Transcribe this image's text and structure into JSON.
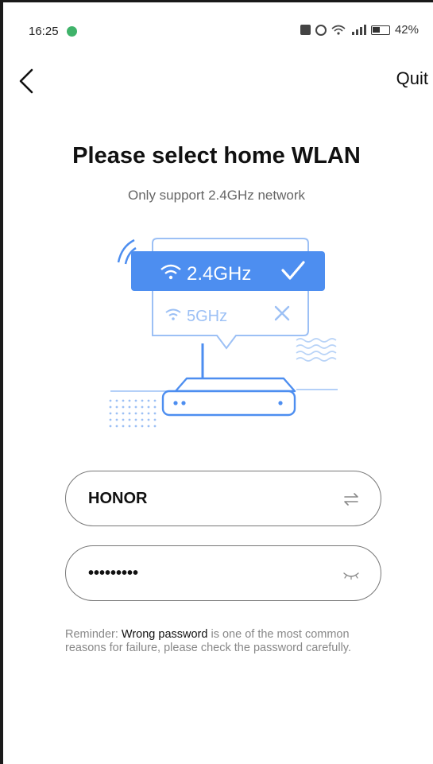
{
  "status_bar": {
    "time": "16:25",
    "battery": "42%",
    "icons": [
      "notification-icon",
      "nfc-icon",
      "wifi-icon",
      "signal-icon",
      "battery-icon"
    ]
  },
  "header": {
    "back_icon": "chevron-left-icon",
    "quit_label": "Quit"
  },
  "title": "Please select home WLAN",
  "subtitle": "Only support 2.4GHz network",
  "illustration": {
    "band_24": "2.4GHz",
    "band_5": "5GHz"
  },
  "form": {
    "ssid_value": "HONOR",
    "password_value": "•••••••••",
    "switch_icon": "swap-arrows-icon",
    "eye_icon": "eye-closed-icon"
  },
  "reminder": {
    "prefix": "Reminder: ",
    "emphasis": "Wrong password",
    "suffix": " is one of the most common reasons for failure, please check the password carefully."
  },
  "colors": {
    "accent": "#4d8ef0",
    "accent_light": "#9cc0f5",
    "text": "#111111",
    "muted": "#888888"
  }
}
